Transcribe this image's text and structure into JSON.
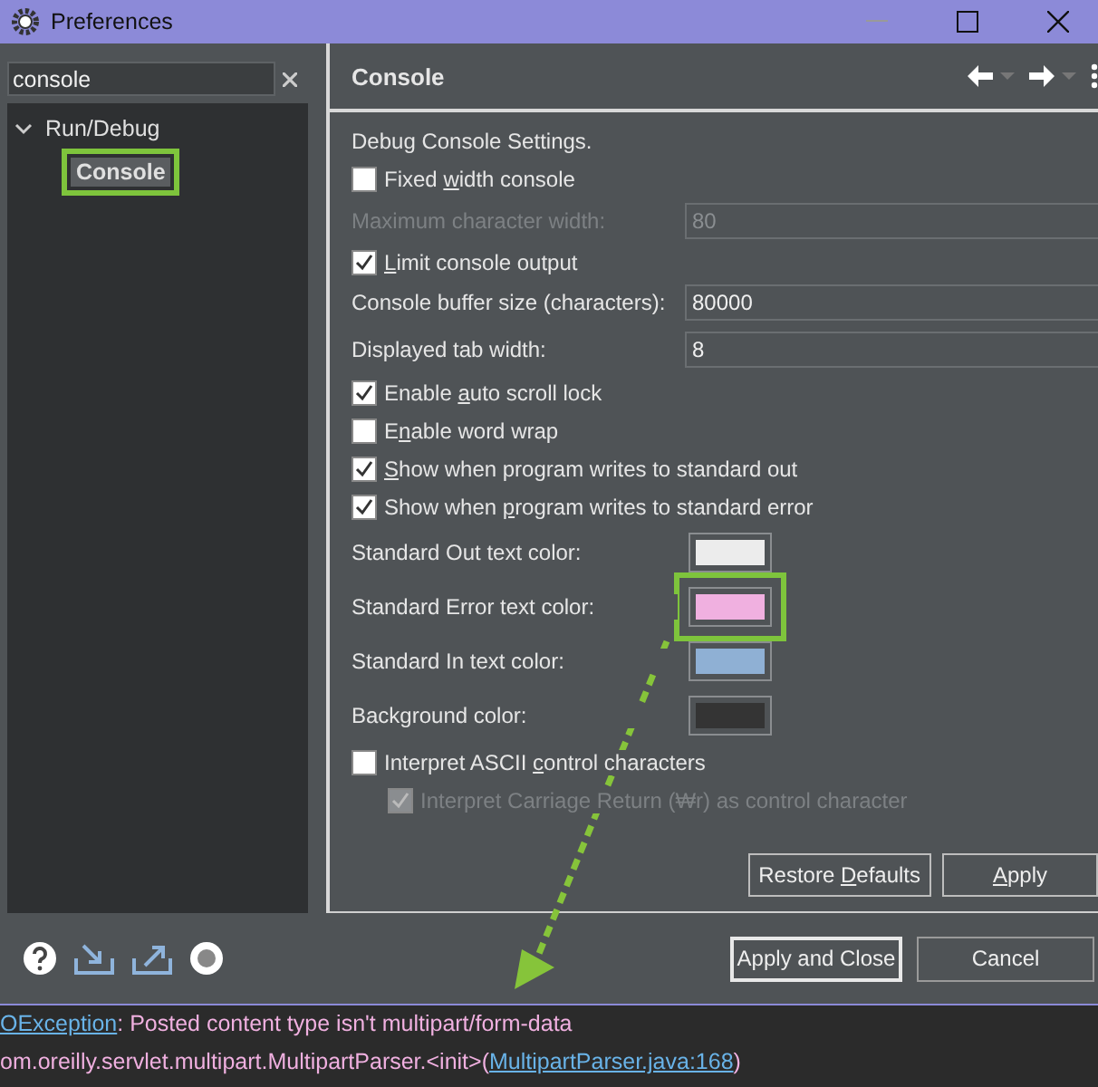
{
  "window": {
    "title": "Preferences"
  },
  "search": {
    "value": "console"
  },
  "tree": [
    {
      "label": "Run/Debug",
      "expanded": true,
      "selected": false,
      "children": [
        {
          "label": "Console",
          "selected": true,
          "highlighted": true
        }
      ]
    }
  ],
  "page": {
    "title": "Console"
  },
  "settings": [
    {
      "kind": "text",
      "label": [
        "Debug Console Settings."
      ]
    },
    {
      "kind": "checkbox",
      "label": {
        "before": "Fixed ",
        "key": "w",
        "after": "idth console"
      },
      "checked": false,
      "disabled": false
    },
    {
      "kind": "field",
      "label": [
        "Maximum character width:"
      ],
      "value": "80",
      "disabled": true
    },
    {
      "kind": "checkbox",
      "label": {
        "key": "L",
        "after": "imit console output"
      },
      "checked": true,
      "disabled": false
    },
    {
      "kind": "field",
      "label": [
        "Console buffer size (characters):"
      ],
      "value": "80000",
      "disabled": false
    },
    {
      "kind": "field",
      "label": [
        "Displayed tab width:"
      ],
      "value": "8",
      "disabled": false
    },
    {
      "kind": "checkbox",
      "label": {
        "before": "Enable ",
        "key": "a",
        "after": "uto scroll lock"
      },
      "checked": true,
      "disabled": false
    },
    {
      "kind": "checkbox",
      "label": {
        "before": "E",
        "key": "n",
        "after": "able word wrap"
      },
      "checked": false,
      "disabled": false
    },
    {
      "kind": "checkbox",
      "label": {
        "key": "S",
        "after": "how when program writes to standard out"
      },
      "checked": true,
      "disabled": false
    },
    {
      "kind": "checkbox",
      "label": {
        "before": "Show when ",
        "key": "p",
        "after": "rogram writes to standard error"
      },
      "checked": true,
      "disabled": false
    },
    {
      "kind": "color",
      "label": [
        "Standard Out text color:"
      ],
      "color": "#ececec",
      "highlighted": false
    },
    {
      "kind": "color",
      "label": [
        "Standard Error text color:"
      ],
      "color": "#f0b0e0",
      "highlighted": true
    },
    {
      "kind": "color",
      "label": [
        "Standard In text color:"
      ],
      "color": "#8fb0d4",
      "highlighted": false
    },
    {
      "kind": "color",
      "label": [
        "Background color:"
      ],
      "color": "#343434",
      "highlighted": false
    },
    {
      "kind": "checkbox",
      "label": {
        "before": "Interpret ASCII ",
        "key": "c",
        "after": "ontrol characters"
      },
      "checked": false,
      "disabled": false
    },
    {
      "kind": "subcheckbox",
      "label": [
        "Interpret Carriage Return (₩r) as control character"
      ],
      "checked": true,
      "disabled": true
    }
  ],
  "page_buttons": [
    {
      "label": {
        "before": "Restore ",
        "key": "D",
        "after": "efaults"
      }
    },
    {
      "label": {
        "key": "A",
        "after": "pply"
      }
    }
  ],
  "dialog_buttons": [
    {
      "label": "Apply and Close",
      "default": true
    },
    {
      "label": "Cancel",
      "default": false
    }
  ],
  "console": [
    [
      {
        "text": "OException",
        "link": true
      },
      {
        "text": ": Posted content type isn't multipart/form-data",
        "link": false
      }
    ],
    [
      {
        "text": "om.oreilly.servlet.multipart.MultipartParser.<init>(",
        "link": false
      },
      {
        "text": "MultipartParser.java:168",
        "link": true
      },
      {
        "text": ")",
        "link": false
      }
    ]
  ]
}
